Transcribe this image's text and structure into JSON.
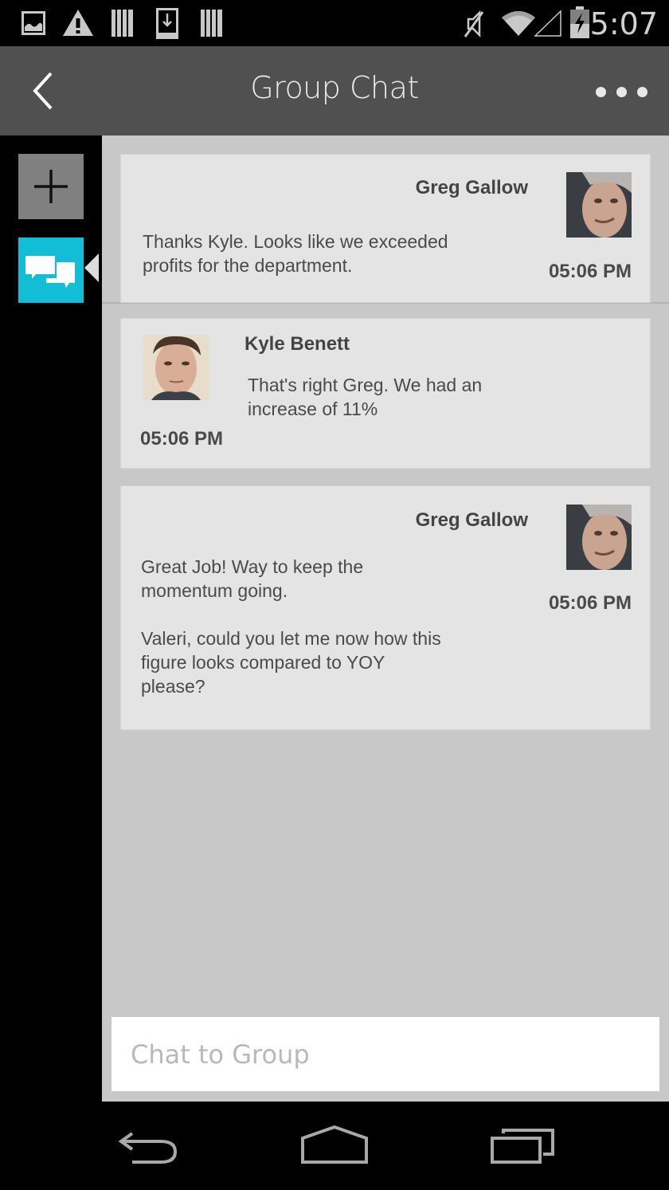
{
  "status_bar": {
    "time": "5:07",
    "left_icons": [
      "image-notification-icon",
      "warning-icon",
      "barcode-icon",
      "download-icon",
      "barcode-icon"
    ],
    "right_icons": [
      "mute-icon",
      "wifi-icon",
      "cell-signal-icon",
      "battery-charging-icon"
    ]
  },
  "app_bar": {
    "title": "Group Chat",
    "back_icon": "chevron-left-icon",
    "menu_icon": "overflow-dots-icon"
  },
  "side_rail": {
    "items": [
      {
        "name": "add",
        "icon": "plus-icon",
        "active": false
      },
      {
        "name": "chat",
        "icon": "chat-bubbles-icon",
        "active": true
      }
    ]
  },
  "messages": [
    {
      "sender": "Greg Gallow",
      "text": "Thanks Kyle. Looks like we exceeded\nprofits for the department.",
      "time": "05:06 PM",
      "align": "right"
    },
    {
      "sender": "Kyle Benett",
      "text": "That's right Greg. We had an\nincrease of 11%",
      "time": "05:06 PM",
      "align": "left"
    },
    {
      "sender": "Greg Gallow",
      "text": "Great Job! Way to keep the\nmomentum going.\n\nValeri, could you let me now how this\nfigure looks compared to YOY\nplease?",
      "time": "05:06 PM",
      "align": "right"
    }
  ],
  "composer": {
    "placeholder": "Chat to Group",
    "value": ""
  },
  "nav_bar": {
    "buttons": [
      "back-icon",
      "home-icon",
      "recent-apps-icon"
    ]
  },
  "colors": {
    "accent": "#12bdd6",
    "app_bar": "#505050",
    "content_bg": "#c8c8c8",
    "card_bg": "#e4e4e4"
  }
}
